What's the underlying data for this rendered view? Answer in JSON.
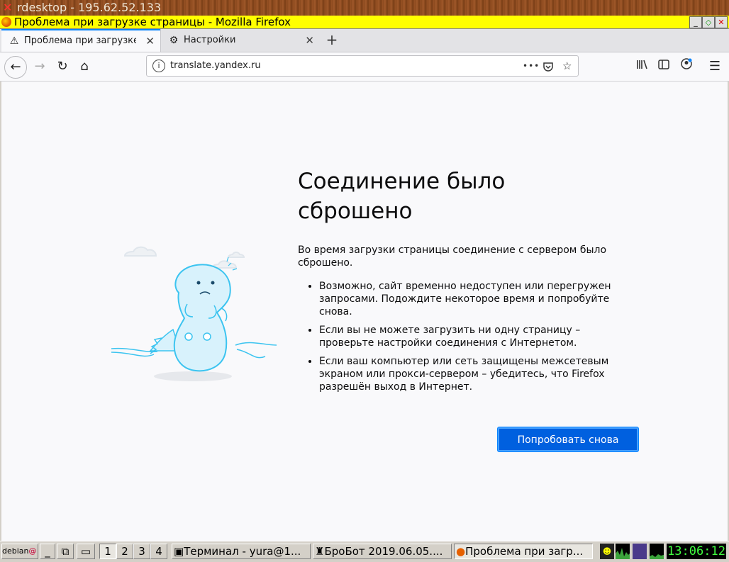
{
  "rdesktop": {
    "title": "rdesktop - 195.62.52.133"
  },
  "window": {
    "title": "Проблема при загрузке страницы - Mozilla Firefox"
  },
  "tabs": [
    {
      "label": "Проблема при загрузке",
      "active": true
    },
    {
      "label": "Настройки",
      "active": false
    }
  ],
  "urlbar": {
    "url": "translate.yandex.ru",
    "more": "•••"
  },
  "error": {
    "title": "Соединение было сброшено",
    "lead": "Во время загрузки страницы соединение с сервером было сброшено.",
    "bullets": [
      "Возможно, сайт временно недоступен или перегружен запросами. Подождите некоторое время и попробуйте снова.",
      "Если вы не можете загрузить ни одну страницу – проверьте настройки соединения с Интернетом.",
      "Если ваш компьютер или сеть защищены межсетевым экраном или прокси-сервером – убедитесь, что Firefox разрешён выход в Интернет."
    ],
    "retry_label": "Попробовать снова"
  },
  "taskbar": {
    "start_label": "debian",
    "desktops": [
      "1",
      "2",
      "3",
      "4"
    ],
    "windows": [
      {
        "label": "Терминал - yura@1..."
      },
      {
        "label": "БроБот 2019.06.05...."
      },
      {
        "label": "Проблема при загр..."
      }
    ],
    "clock": "13:06:12"
  },
  "colors": {
    "accent": "#0060df",
    "title_yellow": "#ffff00",
    "clock_green": "#40ff40"
  }
}
